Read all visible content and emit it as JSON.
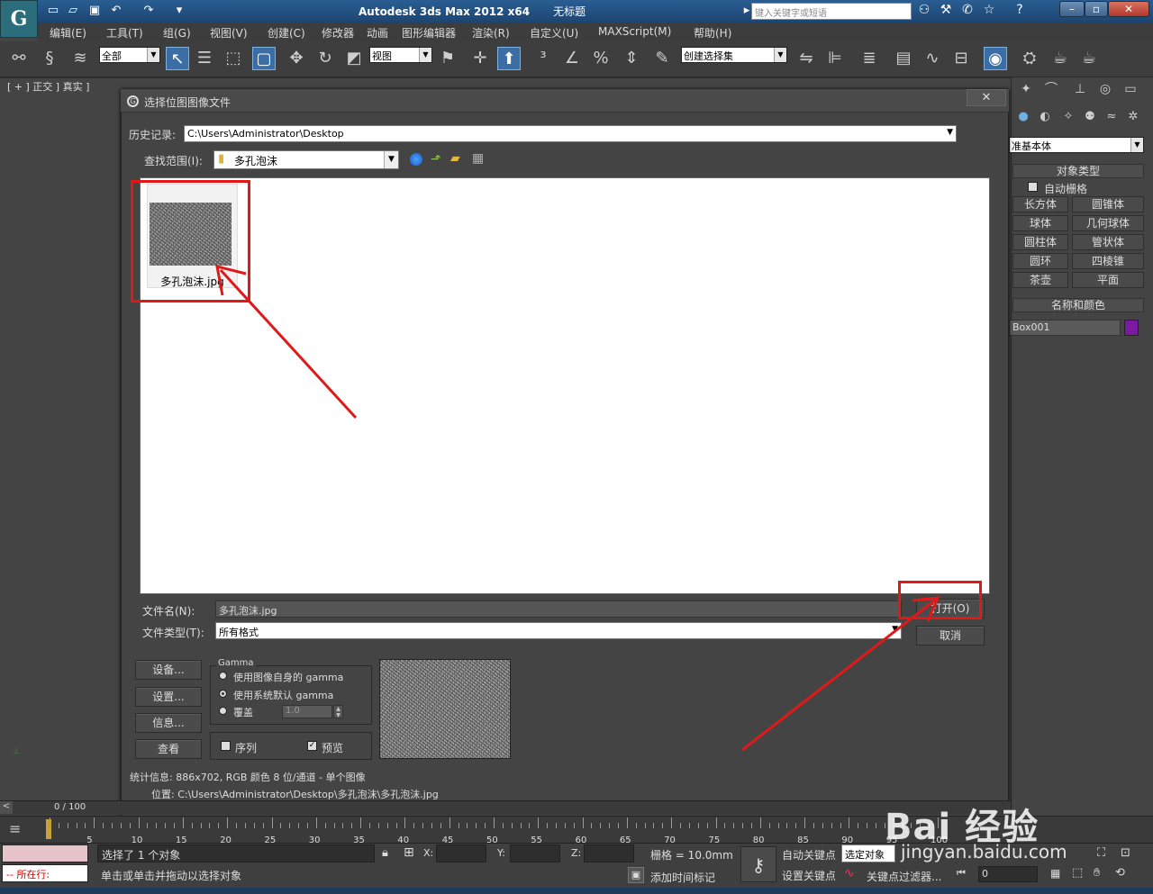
{
  "app": {
    "title": "Autodesk 3ds Max  2012 x64",
    "doc_title": "无标题",
    "search_placeholder": "键入关键字或短语",
    "logo_text": "G"
  },
  "menu": [
    "编辑(E)",
    "工具(T)",
    "组(G)",
    "视图(V)",
    "创建(C)",
    "修改器",
    "动画",
    "图形编辑器",
    "渲染(R)",
    "自定义(U)",
    "MAXScript(M)",
    "帮助(H)"
  ],
  "toolbar": {
    "filter_value": "全部",
    "view_value": "视图",
    "selection_set_value": "创建选择集"
  },
  "viewport": {
    "label": "[ + ] 正交 ] 真实 ]"
  },
  "right_panel": {
    "dropdown_value": "准基本体",
    "object_type_header": "对象类型",
    "auto_grid": "自动栅格",
    "buttons": [
      "长方体",
      "圆锥体",
      "球体",
      "几何球体",
      "圆柱体",
      "管状体",
      "圆环",
      "四棱锥",
      "茶壶",
      "平面"
    ],
    "name_color_header": "名称和颜色",
    "object_name": "Box001",
    "object_color": "#7a1aa0"
  },
  "dialog": {
    "title": "选择位图图像文件",
    "history_label": "历史记录:",
    "history_value": "C:\\Users\\Administrator\\Desktop",
    "lookin_label": "查找范围(I):",
    "lookin_value": "多孔泡沫",
    "file": {
      "name": "多孔泡沫.jpg"
    },
    "filename_label": "文件名(N):",
    "filename_value": "多孔泡沫.jpg",
    "filetype_label": "文件类型(T):",
    "filetype_value": "所有格式",
    "open_button": "打开(O)",
    "cancel_button": "取消",
    "left_buttons": [
      "设备...",
      "设置...",
      "信息...",
      "查看"
    ],
    "gamma": {
      "legend": "Gamma",
      "opt1": "使用图像自身的 gamma",
      "opt2": "使用系统默认 gamma",
      "opt3": "覆盖",
      "override_value": "1.0"
    },
    "sequence_label": "序列",
    "preview_label": "预览",
    "stats": "统计信息: 886x702, RGB 颜色 8 位/通道 - 单个图像",
    "location": "位置: C:\\Users\\Administrator\\Desktop\\多孔泡沫\\多孔泡沫.jpg"
  },
  "timeline": {
    "frame": "0 / 100",
    "ticks": [
      "5",
      "10",
      "15",
      "20",
      "25",
      "30",
      "35",
      "40",
      "45",
      "50",
      "55",
      "60",
      "65",
      "70",
      "75",
      "80",
      "85",
      "90",
      "95",
      "100"
    ]
  },
  "status": {
    "selected": "选择了 1 个对象",
    "hint": "单击或单击并拖动以选择对象",
    "running_label": "所在行:",
    "x_label": "X:",
    "y_label": "Y:",
    "z_label": "Z:",
    "grid": "栅格 = 10.0mm",
    "add_time_tag": "添加时间标记",
    "auto_key": "自动关键点",
    "set_key": "设置关键点",
    "selected_object": "选定对象",
    "key_filter": "关键点过滤器...",
    "frame_value": "0"
  },
  "watermark": "Bai 经验",
  "watermark_url": "jingyan.baidu.com"
}
